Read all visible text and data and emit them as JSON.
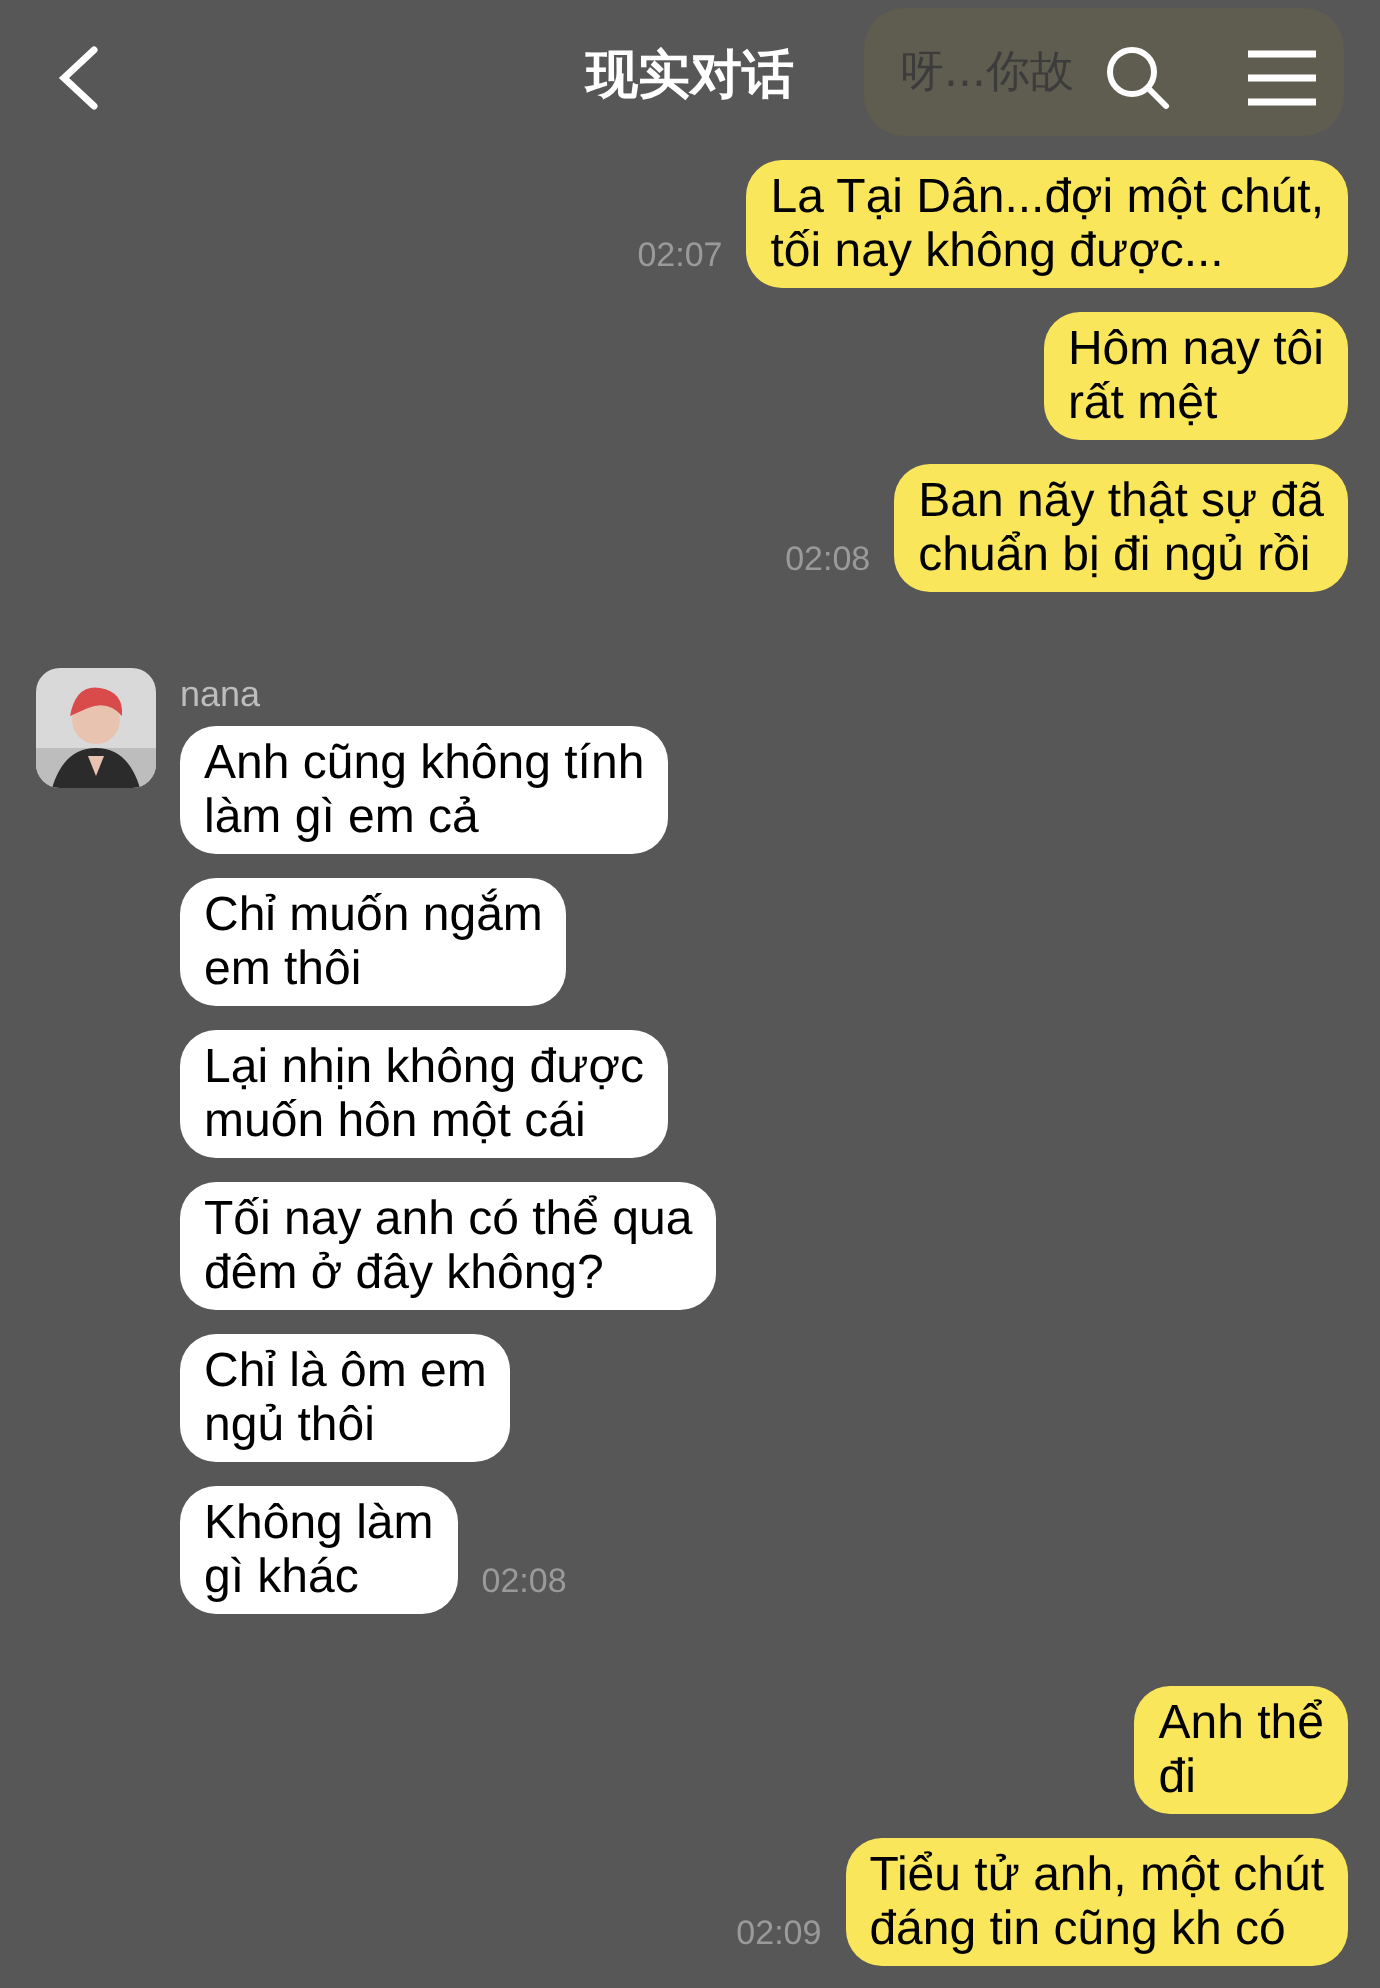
{
  "header": {
    "title": "现实对话",
    "banner": "呀...你故"
  },
  "messages": [
    {
      "kind": "out",
      "text": "La Tại Dân...đợi một chút,\ntối nay không được...",
      "time": "02:07"
    },
    {
      "kind": "out",
      "text": "Hôm nay tôi\nrất mệt"
    },
    {
      "kind": "out",
      "text": "Ban nãy thật sự đã\nchuẩn bị đi ngủ rồi",
      "time": "02:08"
    },
    {
      "kind": "in",
      "sender": "nana",
      "text": "Anh cũng không tính\nlàm gì em cả"
    },
    {
      "kind": "in",
      "text": "Chỉ muốn ngắm\nem thôi"
    },
    {
      "kind": "in",
      "text": "Lại nhịn không được\nmuốn hôn một cái"
    },
    {
      "kind": "in",
      "text": "Tối nay anh có thể qua\nđêm ở đây không?"
    },
    {
      "kind": "in",
      "text": "Chỉ là ôm em\nngủ thôi"
    },
    {
      "kind": "in",
      "text": "Không làm\ngì khác",
      "time": "02:08"
    },
    {
      "kind": "out",
      "text": "Anh thể\nđi"
    },
    {
      "kind": "out",
      "text": "Tiểu tử anh, một chút\nđáng tin cũng kh có",
      "time": "02:09"
    }
  ]
}
